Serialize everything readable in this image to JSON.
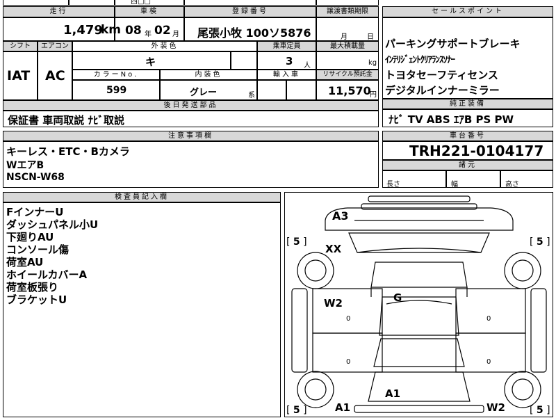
{
  "top_partial": {
    "text": "西□□"
  },
  "basic": {
    "mileage_label": "走行",
    "mileage_value": "1,479",
    "mileage_unit": "km",
    "inspection_label": "車検",
    "inspection_year": "08",
    "inspection_year_unit": "年",
    "inspection_month": "02",
    "inspection_month_unit": "月",
    "registration_label": "登録番号",
    "registration_value": "尾張小牧 100ソ5876",
    "transfer_label": "譲渡書類期限",
    "transfer_month": "月",
    "transfer_day": "日"
  },
  "specs": {
    "shift_label": "シフト",
    "shift_value": "IAT",
    "aircon_label": "エアコン",
    "aircon_value": "AC",
    "exterior_color_label": "外装色",
    "exterior_color_value": "キ",
    "color_no_label": "カラーNo.",
    "color_no_value": "599",
    "interior_color_label": "内装色",
    "interior_color_value": "グレー",
    "interior_suffix": "系",
    "capacity_label": "乗車定員",
    "capacity_value": "3",
    "capacity_unit": "人",
    "max_load_label": "最大積載量",
    "max_load_unit": "kg",
    "import_label": "輸入車",
    "recycle_label": "リサイクル預託金",
    "recycle_value": "11,570",
    "recycle_unit": "円"
  },
  "documents": {
    "header": "後日発送部品",
    "value": "保証書 車両取説 ﾅﾋﾞ取説"
  },
  "sales_points": {
    "header": "セールスポイント",
    "items": [
      "パーキングサポートブレーキ",
      "ｲﾝﾃﾘｼﾞｪﾝﾄｸﾘｱﾗﾝｽｿﾅｰ",
      "トヨタセーフティセンス",
      "デジタルインナーミラー"
    ]
  },
  "equipment": {
    "header": "純正装備",
    "value": "ﾅﾋﾞ TV ABS ｴｱB PS PW"
  },
  "notes": {
    "header": "注意事項欄",
    "lines": [
      "キーレス・ETC・Bカメラ",
      "WエアB",
      "NSCN-W68"
    ]
  },
  "chassis": {
    "header": "車台番号",
    "value": "TRH221-0104177",
    "dims_header": "諸元",
    "length_label": "長さ",
    "width_label": "幅",
    "height_label": "高さ"
  },
  "inspector": {
    "header": "検査員記入欄",
    "lines": [
      "FインナーU",
      "ダッシュパネル小U",
      "下廻りAU",
      "コンソール傷",
      "荷室AU",
      "ホイールカバーA",
      "荷室板張り",
      "ブラケットU"
    ]
  },
  "diagram": {
    "marks": {
      "roof": "A3",
      "front_left": "XX",
      "left_door": "W2",
      "glass": "G",
      "floor": "A1",
      "rear_left": "A1",
      "rear_right": "W2",
      "zero": "0"
    },
    "tire_ratings": {
      "front_left": "5",
      "front_right": "5",
      "rear_left": "5",
      "rear_right": "5"
    }
  }
}
